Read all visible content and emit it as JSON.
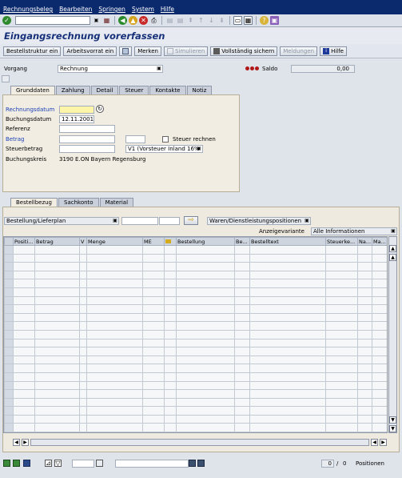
{
  "menu": {
    "items": [
      "Rechnungsbeleg",
      "Bearbeiten",
      "Springen",
      "System",
      "Hilfe"
    ]
  },
  "title": "Eingangsrechnung vorerfassen",
  "toolbar": {
    "bestellstruktur_label": "Bestellstruktur ein",
    "arbeitsvorrat_label": "Arbeitsvorrat ein",
    "merken_label": "Merken",
    "simulieren_label": "Simulieren",
    "sichern_label": "Vollständig sichern",
    "meldungen_label": "Meldungen",
    "hilfe_label": "Hilfe"
  },
  "header": {
    "vorgang_label": "Vorgang",
    "vorgang_value": "Rechnung",
    "saldo_label": "Saldo",
    "saldo_value": "0,00"
  },
  "tabs_top": [
    "Grunddaten",
    "Zahlung",
    "Detail",
    "Steuer",
    "Kontakte",
    "Notiz"
  ],
  "grunddaten": {
    "rechnungsdatum_label": "Rechnungsdatum",
    "rechnungsdatum_value": "",
    "buchungsdatum_label": "Buchungsdatum",
    "buchungsdatum_value": "12.11.2001",
    "referenz_label": "Referenz",
    "betrag_label": "Betrag",
    "steuer_rechnen_label": "Steuer rechnen",
    "steuerbetrag_label": "Steuerbetrag",
    "steuerkennzeichen_value": "V1 (Vorsteuer Inland 16%",
    "buchungskreis_label": "Buchungskreis",
    "buchungskreis_value": "3190 E.ON Bayern Regensburg"
  },
  "tabs_bottom": [
    "Bestellbezug",
    "Sachkonto",
    "Material"
  ],
  "bestellbezug": {
    "bestellung_dropdown": "Bestellung/Lieferplan",
    "waren_dropdown": "Waren/Dienstleistungspositionen",
    "anzeigevariante_label": "Anzeigevariante",
    "anzeigevariante_value": "Alle Informationen"
  },
  "table": {
    "columns": [
      "Positi...",
      "Betrag",
      "V",
      "Menge",
      "ME",
      "",
      "Bestellung",
      "Be...",
      "Bestelltext",
      "Steuerke...",
      "Na...",
      "Ma..."
    ],
    "row_count": 22
  },
  "footer": {
    "count_current": "0",
    "count_sep": "/",
    "count_total": "0",
    "positionen_label": "Positionen"
  }
}
